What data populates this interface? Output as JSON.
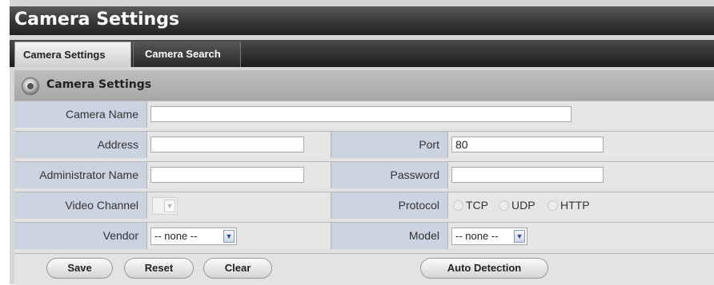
{
  "window": {
    "title": "Camera Settings"
  },
  "tabs": [
    {
      "label": "Camera Settings",
      "active": true
    },
    {
      "label": "Camera Search",
      "active": false
    }
  ],
  "section": {
    "title": "Camera Settings",
    "icon": "camera-icon"
  },
  "form": {
    "camera_name": {
      "label": "Camera Name",
      "value": ""
    },
    "address": {
      "label": "Address",
      "value": ""
    },
    "port": {
      "label": "Port",
      "value": "80"
    },
    "admin_name": {
      "label": "Administrator Name",
      "value": ""
    },
    "password": {
      "label": "Password",
      "value": ""
    },
    "video_channel": {
      "label": "Video Channel",
      "value": ""
    },
    "protocol": {
      "label": "Protocol",
      "options": [
        "TCP",
        "UDP",
        "HTTP"
      ]
    },
    "vendor": {
      "label": "Vendor",
      "value": "-- none --"
    },
    "model": {
      "label": "Model",
      "value": "-- none --"
    }
  },
  "buttons": {
    "save": "Save",
    "reset": "Reset",
    "clear": "Clear",
    "auto_detection": "Auto Detection"
  },
  "colors": {
    "label_cell_bg": "#ccd3e0",
    "title_bar": "#3c3c3c",
    "panel_bg": "#e3e3e3"
  }
}
